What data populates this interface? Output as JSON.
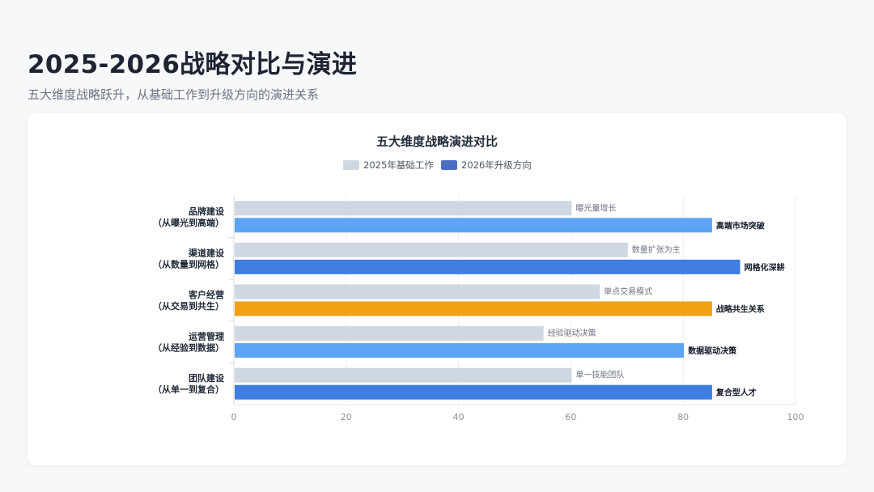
{
  "header": {
    "title": "2025-2026战略对比与演进",
    "subtitle": "五大维度战略跃升，从基础工作到升级方向的演进关系"
  },
  "colors": {
    "base_bar": "#cfd7e2",
    "upgrade_light": "#5ea4f4",
    "upgrade_dark": "#3f7de0",
    "highlight": "#f3a012",
    "legend_upgrade": "#4a6fc2",
    "axis_text": "#8a8f98",
    "grid": "#eceef1"
  },
  "chart_data": {
    "type": "bar",
    "orientation": "horizontal",
    "title": "五大维度战略演进对比",
    "legend": [
      "2025年基础工作",
      "2026年升级方向"
    ],
    "legend_position": "top-center",
    "categories": [
      [
        "品牌建设",
        "（从曝光到高端）"
      ],
      [
        "渠道建设",
        "（从数量到网格）"
      ],
      [
        "客户经营",
        "（从交易到共生）"
      ],
      [
        "运营管理",
        "（从经验到数据）"
      ],
      [
        "团队建设",
        "（从单一到复合）"
      ]
    ],
    "series": [
      {
        "name": "2025年基础工作",
        "values": [
          60,
          70,
          65,
          55,
          60
        ],
        "labels": [
          "曝光量增长",
          "数量扩张为主",
          "单点交易模式",
          "经验驱动决策",
          "单一技能团队"
        ],
        "colors": [
          "#cfd7e2",
          "#cfd7e2",
          "#cfd7e2",
          "#cfd7e2",
          "#cfd7e2"
        ]
      },
      {
        "name": "2026年升级方向",
        "values": [
          85,
          90,
          85,
          80,
          85
        ],
        "labels": [
          "高端市场突破",
          "网格化深耕",
          "战略共生关系",
          "数据驱动决策",
          "复合型人才"
        ],
        "colors": [
          "#5ea4f4",
          "#3f7de0",
          "#f3a012",
          "#5ea4f4",
          "#3f7de0"
        ]
      }
    ],
    "xlim": [
      0,
      100
    ],
    "xticks": [
      "0",
      "20",
      "40",
      "60",
      "80",
      "100"
    ],
    "grid": true
  }
}
